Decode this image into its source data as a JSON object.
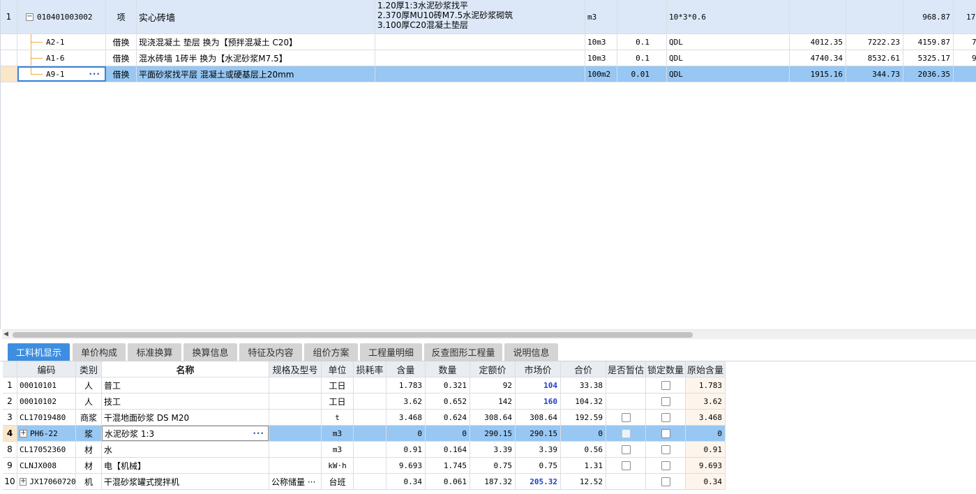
{
  "top_table": {
    "rows": [
      {
        "row_no": "1",
        "code": "010401003002",
        "category": "项",
        "name": "实心砖墙",
        "feature_lines": [
          "1.20厚1:3水泥砂浆找平",
          "2.370厚MU10砖M7.5水泥砂浆砌筑",
          "3.100厚C20混凝土垫层"
        ],
        "unit": "m3",
        "qty_ratio": "",
        "expression": "10*3*0.6",
        "col_a": "",
        "col_b": "",
        "col_c": "968.87",
        "col_d": "17"
      },
      {
        "row_no": "",
        "code": "A2-1",
        "category": "借换",
        "name": "现浇混凝土 垫层  换为【预拌混凝土 C20】",
        "unit": "10m3",
        "qty_ratio": "0.1",
        "expression": "QDL",
        "col_a": "4012.35",
        "col_b": "7222.23",
        "col_c": "4159.87",
        "col_d": "7"
      },
      {
        "row_no": "",
        "code": "A1-6",
        "category": "借换",
        "name": "混水砖墙 1砖半  换为【水泥砂浆M7.5】",
        "unit": "10m3",
        "qty_ratio": "0.1",
        "expression": "QDL",
        "col_a": "4740.34",
        "col_b": "8532.61",
        "col_c": "5325.17",
        "col_d": "9"
      },
      {
        "row_no": "",
        "code": "A9-1",
        "category": "借换",
        "name": "平面砂浆找平层 混凝土或硬基层上20mm",
        "unit": "100m2",
        "qty_ratio": "0.01",
        "expression": "QDL",
        "col_a": "1915.16",
        "col_b": "344.73",
        "col_c": "2036.35",
        "col_d": ""
      }
    ]
  },
  "tabs": [
    "工料机显示",
    "单价构成",
    "标准换算",
    "换算信息",
    "特征及内容",
    "组价方案",
    "工程量明细",
    "反查图形工程量",
    "说明信息"
  ],
  "resource_table": {
    "headers": {
      "code": "编码",
      "type": "类别",
      "name": "名称",
      "spec": "规格及型号",
      "unit": "单位",
      "loss": "损耗率",
      "content": "含量",
      "quantity": "数量",
      "quota_price": "定额价",
      "market_price": "市场价",
      "total": "合价",
      "provisional": "是否暂估",
      "lock_qty": "锁定数量",
      "orig_content": "原始含量"
    },
    "rows": [
      {
        "idx": "1",
        "code": "00010101",
        "type": "人",
        "name": "普工",
        "spec": "",
        "unit": "工日",
        "loss": "",
        "content": "1.783",
        "quantity": "0.321",
        "quota_price": "92",
        "market_price": "104",
        "total": "33.38",
        "orig_content": "1.783"
      },
      {
        "idx": "2",
        "code": "00010102",
        "type": "人",
        "name": "技工",
        "spec": "",
        "unit": "工日",
        "loss": "",
        "content": "3.62",
        "quantity": "0.652",
        "quota_price": "142",
        "market_price": "160",
        "total": "104.32",
        "orig_content": "3.62"
      },
      {
        "idx": "3",
        "code": "CL17019480",
        "type": "商浆",
        "name": "干混地面砂浆 DS M20",
        "spec": "",
        "unit": "t",
        "loss": "",
        "content": "3.468",
        "quantity": "0.624",
        "quota_price": "308.64",
        "market_price": "308.64",
        "total": "192.59",
        "orig_content": "3.468"
      },
      {
        "idx": "4",
        "code": "PH6-22",
        "type": "浆",
        "name": "水泥砂浆 1:3",
        "spec": "",
        "unit": "m3",
        "loss": "",
        "content": "0",
        "quantity": "0",
        "quota_price": "290.15",
        "market_price": "290.15",
        "total": "0",
        "orig_content": "0"
      },
      {
        "idx": "8",
        "code": "CL17052360",
        "type": "材",
        "name": "水",
        "spec": "",
        "unit": "m3",
        "loss": "",
        "content": "0.91",
        "quantity": "0.164",
        "quota_price": "3.39",
        "market_price": "3.39",
        "total": "0.56",
        "orig_content": "0.91"
      },
      {
        "idx": "9",
        "code": "CLNJX008",
        "type": "材",
        "name": "电【机械】",
        "spec": "",
        "unit": "kW·h",
        "loss": "",
        "content": "9.693",
        "quantity": "1.745",
        "quota_price": "0.75",
        "market_price": "0.75",
        "total": "1.31",
        "orig_content": "9.693"
      },
      {
        "idx": "10",
        "code": "JX17060720",
        "type": "机",
        "name": "干混砂浆罐式搅拌机",
        "spec": "公称储量 ···",
        "unit": "台班",
        "loss": "",
        "content": "0.34",
        "quantity": "0.061",
        "quota_price": "187.32",
        "market_price": "205.32",
        "total": "12.52",
        "orig_content": "0.34"
      }
    ]
  }
}
